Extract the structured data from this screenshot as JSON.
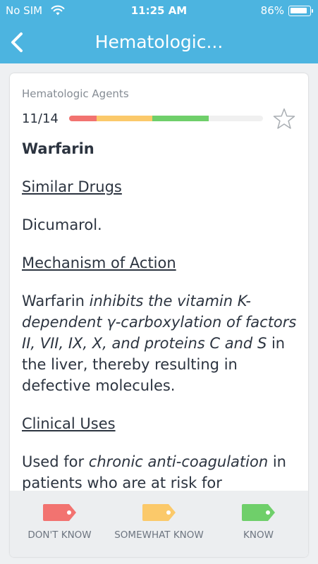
{
  "status_bar": {
    "carrier": "No SIM",
    "time": "11:25 AM",
    "battery": "86%",
    "battery_level": 0.86
  },
  "nav": {
    "title": "Hematologic...",
    "back_icon": "chevron-left-icon"
  },
  "card": {
    "category": "Hematologic Agents",
    "progress": {
      "label": "11/14",
      "segments": [
        {
          "status": "dont_know",
          "fraction": 0.14,
          "color": "#f27370"
        },
        {
          "status": "somewhat_know",
          "fraction": 0.29,
          "color": "#fbc96a"
        },
        {
          "status": "know",
          "fraction": 0.29,
          "color": "#6fcf6a"
        }
      ]
    },
    "star_icon": "star-outline-icon",
    "drug_name": "Warfarin",
    "sections": {
      "similar_drugs": {
        "heading": "Similar Drugs",
        "text": "Dicumarol."
      },
      "mechanism": {
        "heading": "Mechanism of Action",
        "prefix": "Warfarin ",
        "italic": "inhibits the vitamin K-dependent γ-carboxylation of factors II, VII, IX, X, and proteins C and S",
        "suffix": " in the liver, thereby resulting in defective molecules."
      },
      "clinical_uses": {
        "heading": "Clinical Uses",
        "prefix": "Used for ",
        "italic": "chronic anti-coagulation",
        "suffix": " in patients who are at risk for"
      }
    }
  },
  "footer": {
    "buttons": [
      {
        "label": "DON'T KNOW",
        "icon": "tag-icon",
        "color": "#f27370"
      },
      {
        "label": "SOMEWHAT KNOW",
        "icon": "tag-icon",
        "color": "#fbc96a"
      },
      {
        "label": "KNOW",
        "icon": "tag-icon",
        "color": "#6fcf6a"
      }
    ]
  },
  "colors": {
    "header": "#4cb4e0",
    "background": "#eef0f2"
  }
}
